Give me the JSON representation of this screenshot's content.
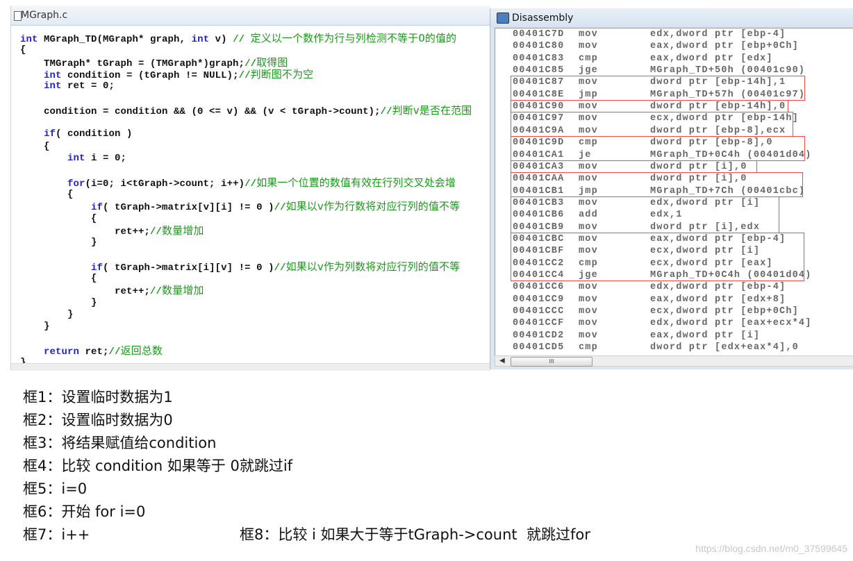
{
  "editor": {
    "title": "MGraph.c",
    "lines": [
      [
        {
          "t": "int",
          "c": "kw"
        },
        {
          "t": " MGraph_TD(MGraph* graph, ",
          "c": "pl"
        },
        {
          "t": "int",
          "c": "kw"
        },
        {
          "t": " v) ",
          "c": "pl"
        },
        {
          "t": "// ",
          "c": "cmslash"
        },
        {
          "t": "定义以一个数作为行与列检测不等于0的值的",
          "c": "cm"
        }
      ],
      [
        {
          "t": "{",
          "c": "pl"
        }
      ],
      [
        {
          "t": "    TMGraph* tGraph = (TMGraph*)graph;",
          "c": "pl"
        },
        {
          "t": "//",
          "c": "cmslash"
        },
        {
          "t": "取得图",
          "c": "cm"
        }
      ],
      [
        {
          "t": "    ",
          "c": "pl"
        },
        {
          "t": "int",
          "c": "kw"
        },
        {
          "t": " condition = (tGraph != NULL);",
          "c": "pl"
        },
        {
          "t": "//",
          "c": "cmslash"
        },
        {
          "t": "判断图不为空",
          "c": "cm"
        }
      ],
      [
        {
          "t": "    ",
          "c": "pl"
        },
        {
          "t": "int",
          "c": "kw"
        },
        {
          "t": " ret = 0;",
          "c": "pl"
        }
      ],
      [],
      [
        {
          "t": "    condition = condition && (0 <= v) && (v < tGraph->count);",
          "c": "pl"
        },
        {
          "t": "//",
          "c": "cmslash"
        },
        {
          "t": "判断v是否在范围",
          "c": "cm"
        }
      ],
      [],
      [
        {
          "t": "    ",
          "c": "pl"
        },
        {
          "t": "if",
          "c": "kw"
        },
        {
          "t": "( condition )",
          "c": "pl"
        }
      ],
      [
        {
          "t": "    {",
          "c": "pl"
        }
      ],
      [
        {
          "t": "        ",
          "c": "pl"
        },
        {
          "t": "int",
          "c": "kw"
        },
        {
          "t": " i = 0;",
          "c": "pl"
        }
      ],
      [],
      [
        {
          "t": "        ",
          "c": "pl"
        },
        {
          "t": "for",
          "c": "kw"
        },
        {
          "t": "(i=0; i<tGraph->count; i++)",
          "c": "pl"
        },
        {
          "t": "//",
          "c": "cmslash"
        },
        {
          "t": "如果一个位置的数值有效在行列交叉处会增",
          "c": "cm"
        }
      ],
      [
        {
          "t": "        {",
          "c": "pl"
        }
      ],
      [
        {
          "t": "            ",
          "c": "pl"
        },
        {
          "t": "if",
          "c": "kw"
        },
        {
          "t": "( tGraph->matrix[v][i] != 0 )",
          "c": "pl"
        },
        {
          "t": "//",
          "c": "cmslash"
        },
        {
          "t": "如果以v作为行数将对应行列的值不等",
          "c": "cm"
        }
      ],
      [
        {
          "t": "            {",
          "c": "pl"
        }
      ],
      [
        {
          "t": "                ret++;",
          "c": "pl"
        },
        {
          "t": "//",
          "c": "cmslash"
        },
        {
          "t": "数量增加",
          "c": "cm"
        }
      ],
      [
        {
          "t": "            }",
          "c": "pl"
        }
      ],
      [],
      [
        {
          "t": "            ",
          "c": "pl"
        },
        {
          "t": "if",
          "c": "kw"
        },
        {
          "t": "( tGraph->matrix[i][v] != 0 )",
          "c": "pl"
        },
        {
          "t": "//",
          "c": "cmslash"
        },
        {
          "t": "如果以v作为列数将对应行列的值不等",
          "c": "cm"
        }
      ],
      [
        {
          "t": "            {",
          "c": "pl"
        }
      ],
      [
        {
          "t": "                ret++;",
          "c": "pl"
        },
        {
          "t": "//",
          "c": "cmslash"
        },
        {
          "t": "数量增加",
          "c": "cm"
        }
      ],
      [
        {
          "t": "            }",
          "c": "pl"
        }
      ],
      [
        {
          "t": "        }",
          "c": "pl"
        }
      ],
      [
        {
          "t": "    }",
          "c": "pl"
        }
      ],
      [],
      [
        {
          "t": "    ",
          "c": "pl"
        },
        {
          "t": "return",
          "c": "kw"
        },
        {
          "t": " ret;",
          "c": "pl"
        },
        {
          "t": "//",
          "c": "cmslash"
        },
        {
          "t": "返回总数",
          "c": "cm"
        }
      ],
      [
        {
          "t": "}",
          "c": "pl"
        }
      ]
    ]
  },
  "disassembly": {
    "title": "Disassembly",
    "scroll_thumb": "III",
    "rows": [
      [
        "00401C7D",
        "mov",
        "edx,dword ptr [ebp-4]"
      ],
      [
        "00401C80",
        "mov",
        "eax,dword ptr [ebp+0Ch]"
      ],
      [
        "00401C83",
        "cmp",
        "eax,dword ptr [edx]"
      ],
      [
        "00401C85",
        "jge",
        "MGraph_TD+50h (00401c90)"
      ],
      [
        "00401C87",
        "mov",
        "dword ptr [ebp-14h],1"
      ],
      [
        "00401C8E",
        "jmp",
        "MGraph_TD+57h (00401c97)"
      ],
      [
        "00401C90",
        "mov",
        "dword ptr [ebp-14h],0"
      ],
      [
        "00401C97",
        "mov",
        "ecx,dword ptr [ebp-14h]"
      ],
      [
        "00401C9A",
        "mov",
        "dword ptr [ebp-8],ecx"
      ],
      [
        "00401C9D",
        "cmp",
        "dword ptr [ebp-8],0"
      ],
      [
        "00401CA1",
        "je",
        "MGraph_TD+0C4h (00401d04)"
      ],
      [
        "00401CA3",
        "mov",
        "dword ptr [i],0"
      ],
      [
        "00401CAA",
        "mov",
        "dword ptr [i],0"
      ],
      [
        "00401CB1",
        "jmp",
        "MGraph_TD+7Ch (00401cbc)"
      ],
      [
        "00401CB3",
        "mov",
        "edx,dword ptr [i]"
      ],
      [
        "00401CB6",
        "add",
        "edx,1"
      ],
      [
        "00401CB9",
        "mov",
        "dword ptr [i],edx"
      ],
      [
        "00401CBC",
        "mov",
        "eax,dword ptr [ebp-4]"
      ],
      [
        "00401CBF",
        "mov",
        "ecx,dword ptr [i]"
      ],
      [
        "00401CC2",
        "cmp",
        "ecx,dword ptr [eax]"
      ],
      [
        "00401CC4",
        "jge",
        "MGraph_TD+0C4h (00401d04)"
      ],
      [
        "00401CC6",
        "mov",
        "edx,dword ptr [ebp-4]"
      ],
      [
        "00401CC9",
        "mov",
        "eax,dword ptr [edx+8]"
      ],
      [
        "00401CCC",
        "mov",
        "ecx,dword ptr [ebp+0Ch]"
      ],
      [
        "00401CCF",
        "mov",
        "edx,dword ptr [eax+ecx*4]"
      ],
      [
        "00401CD2",
        "mov",
        "eax,dword ptr [i]"
      ],
      [
        "00401CD5",
        "cmp",
        "dword ptr [edx+eax*4],0"
      ]
    ],
    "highlight_color": "#ef4b4b"
  },
  "notes": [
    "框1：设置临时数据为1",
    "框2：设置临时数据为0",
    "框3：将结果赋值给condition",
    "框4：比较 condition 如果等于 0就跳过if",
    "框5：i=0",
    "框6：开始 for i=0",
    "框7：i++",
    "框8：比较 i 如果大于等于tGraph->count  就跳过for"
  ],
  "watermark": "https://blog.csdn.net/m0_37599645"
}
